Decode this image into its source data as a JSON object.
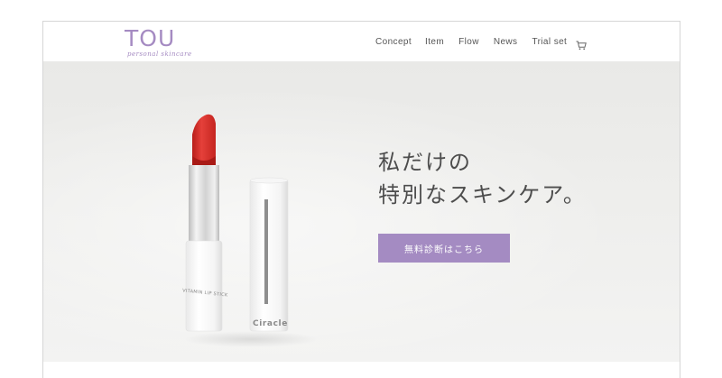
{
  "brand": {
    "name": "TOU",
    "tagline": "personal skincare",
    "color": "#a58bc2"
  },
  "nav": {
    "items": [
      {
        "label": "Concept"
      },
      {
        "label": "Item"
      },
      {
        "label": "Flow"
      },
      {
        "label": "News"
      },
      {
        "label": "Trial set"
      }
    ],
    "cart_icon": "cart-icon"
  },
  "hero": {
    "headline_line1": "私だけの",
    "headline_line2": "特別なスキンケア。",
    "cta_label": "無料診断はこちら",
    "cta_color": "#a48bc2",
    "product": {
      "stick_text": "VITAMIN LIP STICK",
      "cap_brand": "Ciracle",
      "lip_color": "#d9302b"
    }
  }
}
